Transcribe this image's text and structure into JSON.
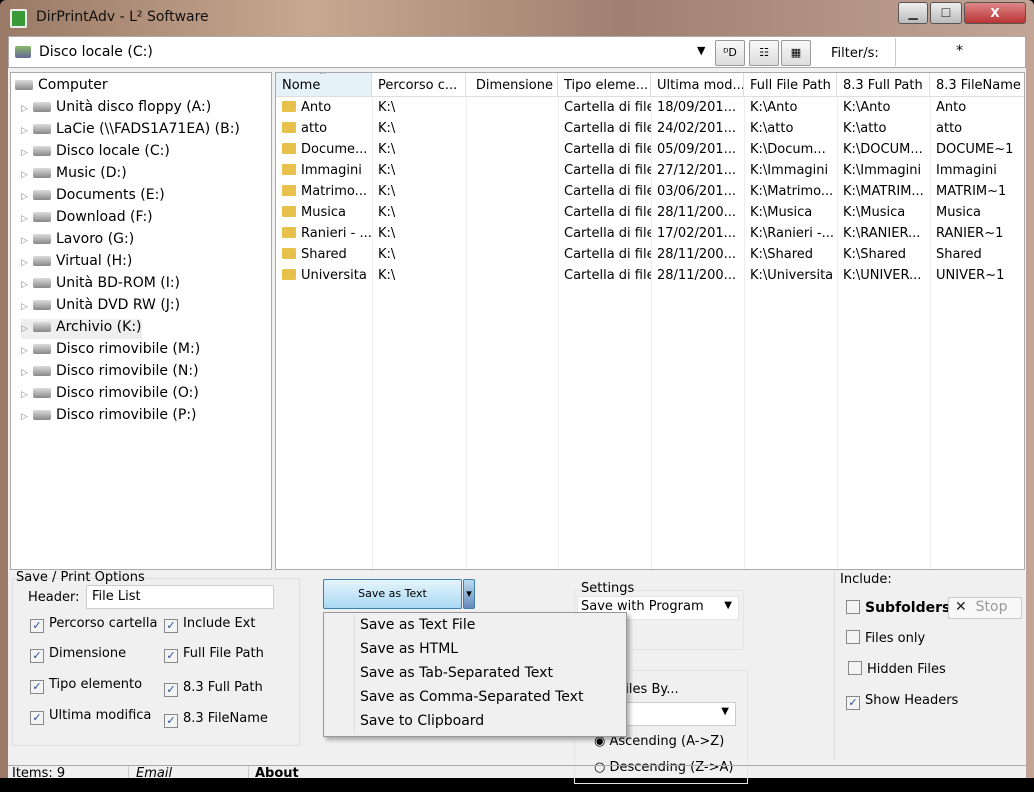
{
  "window": {
    "title": "DirPrintAdv - L² Software",
    "min": "▁",
    "max": "☐",
    "close": "X"
  },
  "toolbar": {
    "drive": "Disco locale (C:)",
    "filter_label": "Filter/s:",
    "filter_value": "*",
    "btn1": "ᴰD",
    "btn2": "☷",
    "btn3": "▦"
  },
  "tree": [
    "Computer",
    "Unità disco floppy (A:)",
    "LaCie (\\\\FADS1A71EA) (B:)",
    "Disco locale (C:)",
    "Music (D:)",
    "Documents (E:)",
    "Download (F:)",
    "Lavoro (G:)",
    "Virtual (H:)",
    "Unità BD-ROM (I:)",
    "Unità DVD RW (J:)",
    "Archivio (K:)",
    "Disco rimovibile (M:)",
    "Disco rimovibile (N:)",
    "Disco rimovibile (O:)",
    "Disco rimovibile (P:)"
  ],
  "columns": [
    "Nome",
    "Percorso c...",
    "Dimensione",
    "Tipo eleme...",
    "Ultima mod...",
    "Full File Path",
    "8.3 Full Path",
    "8.3 FileName"
  ],
  "rows": [
    [
      "Anto",
      "K:\\",
      "",
      "Cartella di file",
      "18/09/201...",
      "K:\\Anto",
      "K:\\Anto",
      "Anto"
    ],
    [
      "atto",
      "K:\\",
      "",
      "Cartella di file",
      "24/02/201...",
      "K:\\atto",
      "K:\\atto",
      "atto"
    ],
    [
      "Docume...",
      "K:\\",
      "",
      "Cartella di file",
      "05/09/201...",
      "K:\\Docum...",
      "K:\\DOCUM...",
      "DOCUME~1"
    ],
    [
      "Immagini",
      "K:\\",
      "",
      "Cartella di file",
      "27/12/201...",
      "K:\\Immagini",
      "K:\\Immagini",
      "Immagini"
    ],
    [
      "Matrimo...",
      "K:\\",
      "",
      "Cartella di file",
      "03/06/201...",
      "K:\\Matrimo...",
      "K:\\MATRIM...",
      "MATRIM~1"
    ],
    [
      "Musica",
      "K:\\",
      "",
      "Cartella di file",
      "28/11/200...",
      "K:\\Musica",
      "K:\\Musica",
      "Musica"
    ],
    [
      "Ranieri - ...",
      "K:\\",
      "",
      "Cartella di file",
      "17/02/201...",
      "K:\\Ranieri -...",
      "K:\\RANIER...",
      "RANIER~1"
    ],
    [
      "Shared",
      "K:\\",
      "",
      "Cartella di file",
      "28/11/200...",
      "K:\\Shared",
      "K:\\Shared",
      "Shared"
    ],
    [
      "Universita",
      "K:\\",
      "",
      "Cartella di file",
      "28/11/200...",
      "K:\\Universita",
      "K:\\UNIVER...",
      "UNIVER~1"
    ]
  ],
  "options": {
    "group": "Save / Print Options",
    "header_label": "Header:",
    "header_value": "File List",
    "checks": [
      {
        "label": "Percorso cartella",
        "checked": true
      },
      {
        "label": "Include Ext",
        "checked": true
      },
      {
        "label": "Dimensione",
        "checked": true
      },
      {
        "label": "Full File Path",
        "checked": true
      },
      {
        "label": "Tipo elemento",
        "checked": true
      },
      {
        "label": "8.3 Full Path",
        "checked": true
      },
      {
        "label": "Ultima modifica",
        "checked": true
      },
      {
        "label": "8.3 FileName",
        "checked": true
      }
    ]
  },
  "save": {
    "button": "Save as Text",
    "arrow": "▾",
    "menu": [
      "Save as Text File",
      "Save as HTML",
      "Save as Tab-Separated Text",
      "Save as Comma-Separated Text",
      "Save to Clipboard"
    ]
  },
  "settings": {
    "label": "Settings",
    "value": "Save with Program",
    "sort_label": "Sort Files By...",
    "asc": "Ascending (A->Z)",
    "desc": "Descending (Z->A)"
  },
  "include": {
    "label": "Include:",
    "subfolders": "Subfolders",
    "stop": "Stop",
    "files_only": "Files only",
    "hidden": "Hidden Files",
    "headers": "Show Headers"
  },
  "status": {
    "items": "Items: 9",
    "email": "Email",
    "about": "About"
  }
}
